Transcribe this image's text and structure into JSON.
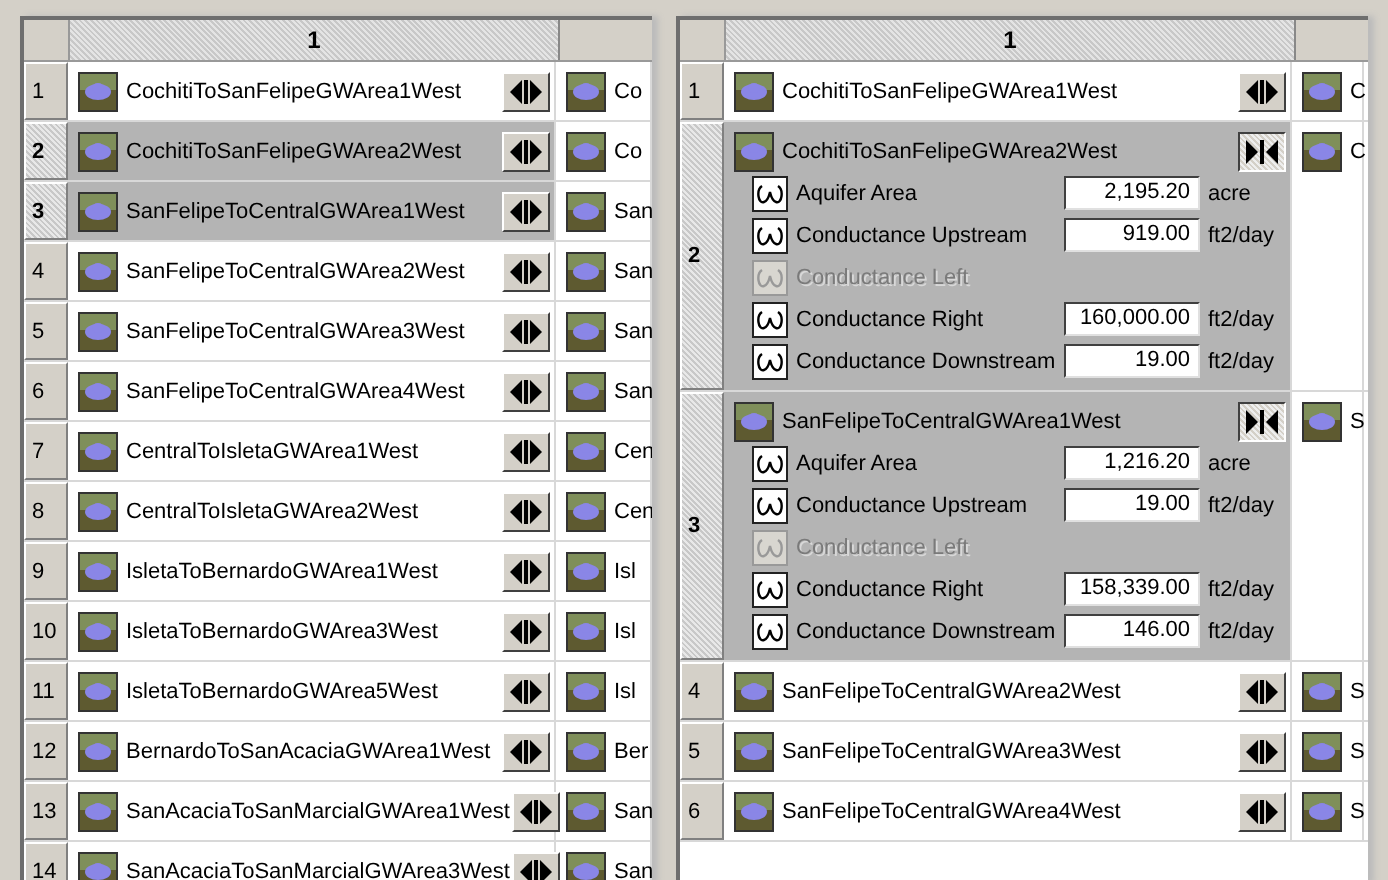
{
  "panels": [
    {
      "column_header": "1",
      "rows": [
        {
          "number": "1",
          "selected": false,
          "expanded": false,
          "name": "CochitiToSanFelipeGWArea1West",
          "column_2": "Co"
        },
        {
          "number": "2",
          "selected": true,
          "expanded": false,
          "name": "CochitiToSanFelipeGWArea2West",
          "column_2": "Co"
        },
        {
          "number": "3",
          "selected": true,
          "expanded": false,
          "name": "SanFelipeToCentralGWArea1West",
          "column_2": "San"
        },
        {
          "number": "4",
          "selected": false,
          "expanded": false,
          "name": "SanFelipeToCentralGWArea2West",
          "column_2": "San"
        },
        {
          "number": "5",
          "selected": false,
          "expanded": false,
          "name": "SanFelipeToCentralGWArea3West",
          "column_2": "San"
        },
        {
          "number": "6",
          "selected": false,
          "expanded": false,
          "name": "SanFelipeToCentralGWArea4West",
          "column_2": "San"
        },
        {
          "number": "7",
          "selected": false,
          "expanded": false,
          "name": "CentralToIsletaGWArea1West",
          "column_2": "Cen"
        },
        {
          "number": "8",
          "selected": false,
          "expanded": false,
          "name": "CentralToIsletaGWArea2West",
          "column_2": "Cen"
        },
        {
          "number": "9",
          "selected": false,
          "expanded": false,
          "name": "IsletaToBernardoGWArea1West",
          "column_2": "Isl"
        },
        {
          "number": "10",
          "selected": false,
          "expanded": false,
          "name": "IsletaToBernardoGWArea3West",
          "column_2": "Isl"
        },
        {
          "number": "11",
          "selected": false,
          "expanded": false,
          "name": "IsletaToBernardoGWArea5West",
          "column_2": "Isl"
        },
        {
          "number": "12",
          "selected": false,
          "expanded": false,
          "name": "BernardoToSanAcaciaGWArea1West",
          "column_2": "Ber"
        },
        {
          "number": "13",
          "selected": false,
          "expanded": false,
          "name": "SanAcaciaToSanMarcialGWArea1West",
          "column_2": "San"
        },
        {
          "number": "14",
          "selected": false,
          "expanded": false,
          "name": "SanAcaciaToSanMarcialGWArea3West",
          "column_2": "San"
        }
      ]
    },
    {
      "column_header": "1",
      "rows": [
        {
          "number": "1",
          "selected": false,
          "expanded": false,
          "name": "CochitiToSanFelipeGWArea1West",
          "column_2": "C"
        },
        {
          "number": "2",
          "selected": true,
          "expanded": true,
          "name": "CochitiToSanFelipeGWArea2West",
          "column_2": "C",
          "parameters": [
            {
              "label": "Aquifer Area",
              "disabled": false,
              "value": "2,195.20",
              "unit": "acre"
            },
            {
              "label": "Conductance Upstream",
              "disabled": false,
              "value": "919.00",
              "unit": "ft2/day"
            },
            {
              "label": "Conductance Left",
              "disabled": true
            },
            {
              "label": "Conductance Right",
              "disabled": false,
              "value": "160,000.00",
              "unit": "ft2/day"
            },
            {
              "label": "Conductance Downstream",
              "disabled": false,
              "value": "19.00",
              "unit": "ft2/day"
            }
          ]
        },
        {
          "number": "3",
          "selected": true,
          "expanded": true,
          "name": "SanFelipeToCentralGWArea1West",
          "column_2": "S",
          "parameters": [
            {
              "label": "Aquifer Area",
              "disabled": false,
              "value": "1,216.20",
              "unit": "acre"
            },
            {
              "label": "Conductance Upstream",
              "disabled": false,
              "value": "19.00",
              "unit": "ft2/day"
            },
            {
              "label": "Conductance Left",
              "disabled": true
            },
            {
              "label": "Conductance Right",
              "disabled": false,
              "value": "158,339.00",
              "unit": "ft2/day"
            },
            {
              "label": "Conductance Downstream",
              "disabled": false,
              "value": "146.00",
              "unit": "ft2/day"
            }
          ]
        },
        {
          "number": "4",
          "selected": false,
          "expanded": false,
          "name": "SanFelipeToCentralGWArea2West",
          "column_2": "S"
        },
        {
          "number": "5",
          "selected": false,
          "expanded": false,
          "name": "SanFelipeToCentralGWArea3West",
          "column_2": "S"
        },
        {
          "number": "6",
          "selected": false,
          "expanded": false,
          "name": "SanFelipeToCentralGWArea4West",
          "column_2": "S"
        }
      ]
    }
  ]
}
